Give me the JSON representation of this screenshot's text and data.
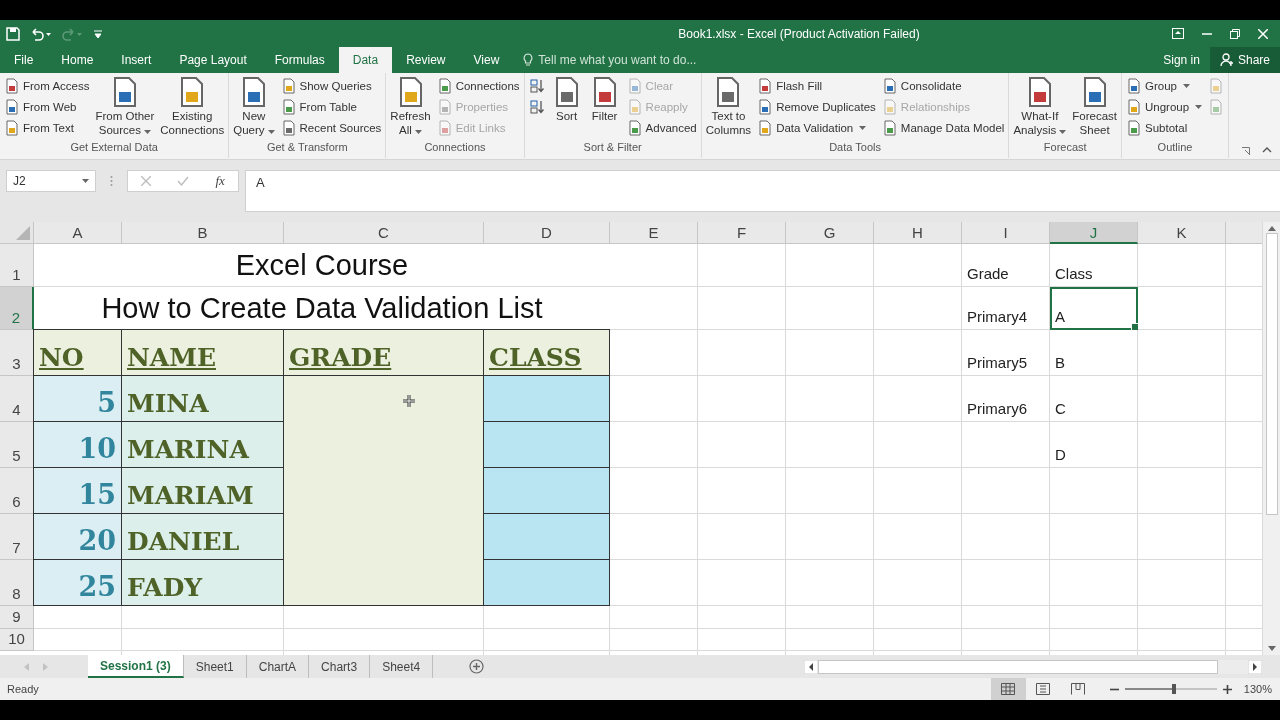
{
  "title_bar": {
    "title": "Book1.xlsx - Excel (Product Activation Failed)"
  },
  "menu_tabs": [
    {
      "label": "File",
      "selected": false
    },
    {
      "label": "Home",
      "selected": false
    },
    {
      "label": "Insert",
      "selected": false
    },
    {
      "label": "Page Layout",
      "selected": false
    },
    {
      "label": "Formulas",
      "selected": false
    },
    {
      "label": "Data",
      "selected": true
    },
    {
      "label": "Review",
      "selected": false
    },
    {
      "label": "View",
      "selected": false
    }
  ],
  "tell_me": {
    "placeholder": "Tell me what you want to do..."
  },
  "account": {
    "sign_in": "Sign in",
    "share": "Share"
  },
  "ribbon_groups": [
    {
      "label": "Get External Data",
      "columns": [
        {
          "kind": "stack",
          "items": [
            {
              "label": "From Access",
              "disabled": false,
              "dropdown": false
            },
            {
              "label": "From Web",
              "disabled": false,
              "dropdown": false
            },
            {
              "label": "From Text",
              "disabled": false,
              "dropdown": false
            }
          ]
        },
        {
          "kind": "large",
          "items": [
            {
              "lines": [
                "From Other",
                "Sources"
              ],
              "disabled": false,
              "dropdown": true
            }
          ]
        },
        {
          "kind": "large",
          "items": [
            {
              "lines": [
                "Existing",
                "Connections"
              ],
              "disabled": false,
              "dropdown": false
            }
          ]
        }
      ]
    },
    {
      "label": "Get & Transform",
      "columns": [
        {
          "kind": "large",
          "items": [
            {
              "lines": [
                "New",
                "Query"
              ],
              "disabled": false,
              "dropdown": true
            }
          ]
        },
        {
          "kind": "stack",
          "items": [
            {
              "label": "Show Queries",
              "disabled": false,
              "dropdown": false
            },
            {
              "label": "From Table",
              "disabled": false,
              "dropdown": false
            },
            {
              "label": "Recent Sources",
              "disabled": false,
              "dropdown": false
            }
          ]
        }
      ]
    },
    {
      "label": "Connections",
      "columns": [
        {
          "kind": "large",
          "items": [
            {
              "lines": [
                "Refresh",
                "All"
              ],
              "disabled": false,
              "dropdown": true
            }
          ]
        },
        {
          "kind": "stack",
          "items": [
            {
              "label": "Connections",
              "disabled": false,
              "dropdown": false
            },
            {
              "label": "Properties",
              "disabled": true,
              "dropdown": false
            },
            {
              "label": "Edit Links",
              "disabled": true,
              "dropdown": false
            }
          ]
        }
      ]
    },
    {
      "label": "Sort & Filter",
      "columns": [
        {
          "kind": "stack",
          "items": [
            {
              "disabled": false,
              "dropdown": false
            },
            {
              "disabled": false,
              "dropdown": false
            }
          ]
        },
        {
          "kind": "large",
          "items": [
            {
              "lines": [
                "Sort"
              ],
              "disabled": false,
              "dropdown": false
            }
          ]
        },
        {
          "kind": "large",
          "items": [
            {
              "lines": [
                "Filter"
              ],
              "disabled": false,
              "dropdown": false
            }
          ]
        },
        {
          "kind": "stack",
          "items": [
            {
              "label": "Clear",
              "disabled": true,
              "dropdown": false
            },
            {
              "label": "Reapply",
              "disabled": true,
              "dropdown": false
            },
            {
              "label": "Advanced",
              "disabled": false,
              "dropdown": false
            }
          ]
        }
      ]
    },
    {
      "label": "Data Tools",
      "columns": [
        {
          "kind": "large",
          "items": [
            {
              "lines": [
                "Text to",
                "Columns"
              ],
              "disabled": false,
              "dropdown": false
            }
          ]
        },
        {
          "kind": "stack",
          "items": [
            {
              "label": "Flash Fill",
              "disabled": false,
              "dropdown": false
            },
            {
              "label": "Remove Duplicates",
              "disabled": false,
              "dropdown": false
            },
            {
              "label": "Data Validation",
              "disabled": false,
              "dropdown": true
            }
          ]
        },
        {
          "kind": "stack",
          "items": [
            {
              "label": "Consolidate",
              "disabled": false,
              "dropdown": false
            },
            {
              "label": "Relationships",
              "disabled": true,
              "dropdown": false
            },
            {
              "label": "Manage Data Model",
              "disabled": false,
              "dropdown": false
            }
          ]
        }
      ]
    },
    {
      "label": "Forecast",
      "columns": [
        {
          "kind": "large",
          "items": [
            {
              "lines": [
                "What-If",
                "Analysis"
              ],
              "disabled": false,
              "dropdown": true
            }
          ]
        },
        {
          "kind": "large",
          "items": [
            {
              "lines": [
                "Forecast",
                "Sheet"
              ],
              "disabled": false,
              "dropdown": false
            }
          ]
        }
      ]
    },
    {
      "label": "Outline",
      "columns": [
        {
          "kind": "stack",
          "items": [
            {
              "label": "Group",
              "disabled": false,
              "dropdown": true
            },
            {
              "label": "Ungroup",
              "disabled": false,
              "dropdown": true
            },
            {
              "label": "Subtotal",
              "disabled": false,
              "dropdown": false
            }
          ]
        },
        {
          "kind": "stack",
          "items": [
            {
              "disabled": true,
              "dropdown": false
            },
            {
              "disabled": true,
              "dropdown": false
            }
          ]
        }
      ]
    }
  ],
  "formula_bar": {
    "name_box": "J2",
    "function_label": "fx",
    "value": "A"
  },
  "sheet": {
    "columns": [
      {
        "label": "A",
        "selected": false
      },
      {
        "label": "B",
        "selected": false
      },
      {
        "label": "C",
        "selected": false
      },
      {
        "label": "D",
        "selected": false
      },
      {
        "label": "E",
        "selected": false
      },
      {
        "label": "F",
        "selected": false
      },
      {
        "label": "G",
        "selected": false
      },
      {
        "label": "H",
        "selected": false
      },
      {
        "label": "I",
        "selected": false
      },
      {
        "label": "J",
        "selected": true
      },
      {
        "label": "K",
        "selected": false
      }
    ],
    "rows": [
      {
        "label": "1",
        "selected": false
      },
      {
        "label": "2",
        "selected": true
      },
      {
        "label": "3",
        "selected": false
      },
      {
        "label": "4",
        "selected": false
      },
      {
        "label": "5",
        "selected": false
      },
      {
        "label": "6",
        "selected": false
      },
      {
        "label": "7",
        "selected": false
      },
      {
        "label": "8",
        "selected": false
      },
      {
        "label": "9",
        "selected": false
      },
      {
        "label": "10",
        "selected": false
      }
    ],
    "banner": [
      "Excel Course",
      "How to Create Data Validation List"
    ],
    "table": {
      "headers": [
        "NO",
        "NAME",
        "GRADE",
        "CLASS"
      ],
      "rows": [
        {
          "no": "5",
          "name": "MINA"
        },
        {
          "no": "10",
          "name": "MARINA"
        },
        {
          "no": "15",
          "name": "MARIAM"
        },
        {
          "no": "20",
          "name": "DANIEL"
        },
        {
          "no": "25",
          "name": "FADY"
        }
      ]
    },
    "lookup": {
      "headers": [
        "Grade",
        "Class"
      ],
      "grades": [
        "Primary4",
        "Primary5",
        "Primary6"
      ],
      "classes": [
        {
          "text": "A",
          "selected": true
        },
        {
          "text": "B",
          "selected": false
        },
        {
          "text": "C",
          "selected": false
        },
        {
          "text": "D",
          "selected": false
        }
      ]
    }
  },
  "sheet_tabs": [
    {
      "label": "Session1 (3)",
      "selected": true
    },
    {
      "label": "Sheet1",
      "selected": false
    },
    {
      "label": "ChartA",
      "selected": false
    },
    {
      "label": "Chart3",
      "selected": false
    },
    {
      "label": "Sheet4",
      "selected": false
    }
  ],
  "status_bar": {
    "status": "Ready",
    "views": [
      {
        "selected": true
      },
      {
        "selected": false
      },
      {
        "selected": false
      }
    ],
    "zoom": {
      "level": 0.53,
      "reading": "130%"
    }
  }
}
